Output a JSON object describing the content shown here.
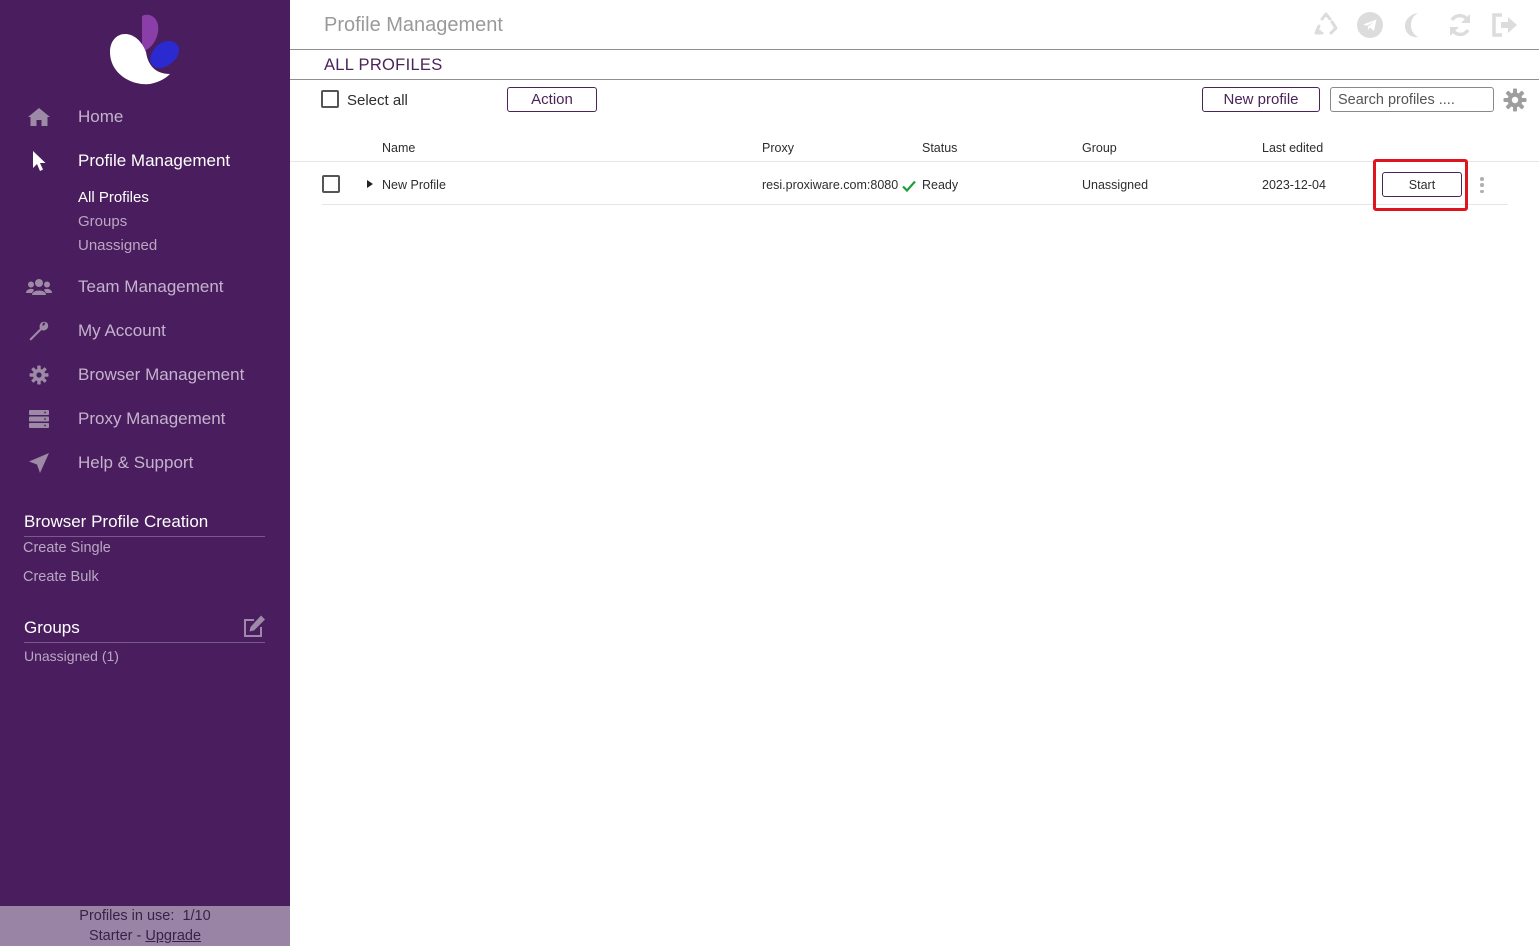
{
  "sidebar": {
    "nav": [
      {
        "label": "Home",
        "icon": "home-icon"
      },
      {
        "label": "Profile Management",
        "icon": "pointer-icon",
        "active": true
      },
      {
        "label": "Team Management",
        "icon": "users-icon"
      },
      {
        "label": "My Account",
        "icon": "wrench-icon"
      },
      {
        "label": "Browser Management",
        "icon": "gear-icon"
      },
      {
        "label": "Proxy Management",
        "icon": "server-icon"
      },
      {
        "label": "Help & Support",
        "icon": "paper-plane-icon"
      }
    ],
    "profile_subnav": [
      "All Profiles",
      "Groups",
      "Unassigned"
    ],
    "creation": {
      "title": "Browser Profile Creation",
      "links": [
        "Create Single",
        "Create Bulk"
      ]
    },
    "groups": {
      "title": "Groups",
      "items": [
        "Unassigned (1)"
      ]
    },
    "footer": {
      "usage_label": "Profiles in use:",
      "usage_value": "1/10",
      "plan": "Starter",
      "separator": " - ",
      "upgrade": "Upgrade"
    }
  },
  "header": {
    "title": "Profile Management",
    "icons": [
      "recycle-icon",
      "telegram-icon",
      "moon-icon",
      "refresh-icon",
      "logout-icon"
    ]
  },
  "subheader": {
    "title": "ALL PROFILES"
  },
  "toolbar": {
    "select_all": "Select all",
    "action": "Action",
    "new_profile": "New profile",
    "search_placeholder": "Search profiles ...."
  },
  "table": {
    "columns": {
      "name": "Name",
      "proxy": "Proxy",
      "status": "Status",
      "group": "Group",
      "last_edited": "Last edited"
    },
    "rows": [
      {
        "name": "New Profile",
        "proxy": "resi.proxiware.com:8080",
        "status": "Ready",
        "group": "Unassigned",
        "last_edited": "2023-12-04",
        "start_label": "Start"
      }
    ]
  },
  "colors": {
    "sidebar_bg": "#4a1d5e",
    "footer_bg": "#9a84a6",
    "accent": "#4a2458",
    "highlight": "#e0141e",
    "proxy_ok": "#1e9e3a"
  }
}
